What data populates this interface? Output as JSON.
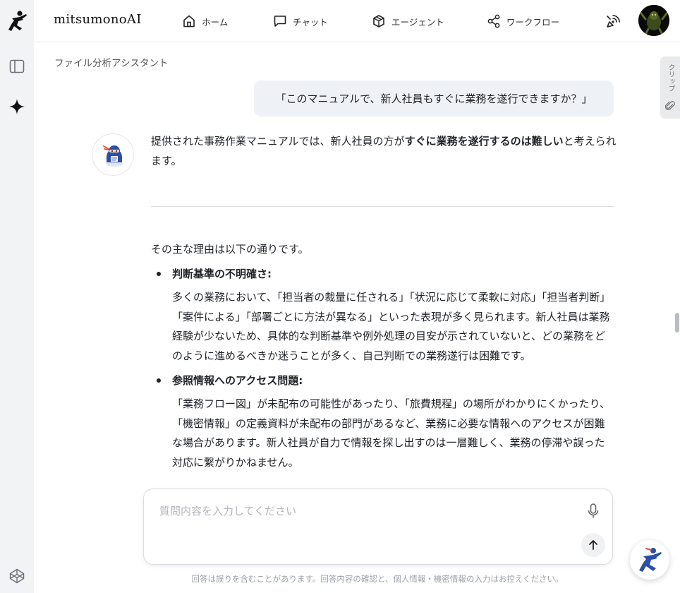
{
  "header": {
    "brand": "mitsumonoAI",
    "nav": [
      {
        "label": "ホーム",
        "icon": "home-icon"
      },
      {
        "label": "チャット",
        "icon": "chat-icon"
      },
      {
        "label": "エージェント",
        "icon": "cube-icon"
      },
      {
        "label": "ワークフロー",
        "icon": "share-icon"
      }
    ]
  },
  "page": {
    "title": "ファイル分析アシスタント"
  },
  "clip_tab": {
    "label": "クリップ"
  },
  "conversation": {
    "user_message": "「このマニュアルで、新人社員もすぐに業務を遂行できますか？」",
    "answer_pre": "提供された事務作業マニュアルでは、新人社員の方が",
    "answer_bold": "すぐに業務を遂行するのは難しい",
    "answer_post": "と考えられます。",
    "reasons_lead": "その主な理由は以下の通りです。",
    "reasons": [
      {
        "title": "判断基準の不明確さ:",
        "body": "多くの業務において、「担当者の裁量に任される」「状況に応じて柔軟に対応」「担当者判断」「案件による」「部署ごとに方法が異なる」といった表現が多く見られます。新人社員は業務経験が少ないため、具体的な判断基準や例外処理の目安が示されていないと、どの業務をどのように進めるべきか迷うことが多く、自己判断での業務遂行は困難です。"
      },
      {
        "title": "参照情報へのアクセス問題:",
        "body": "「業務フロー図」が未配布の可能性があったり、「旅費規程」の場所がわかりにくかったり、「機密情報」の定義資料が未配布の部門があるなど、業務に必要な情報へのアクセスが困難な場合があります。新人社員が自力で情報を探し出すのは一層難しく、業務の停滞や誤った対応に繋がりかねません。"
      }
    ]
  },
  "input": {
    "placeholder": "質問内容を入力してください"
  },
  "disclaimer": "回答は誤りを含むことがあります。回答内容の確認と、個人情報・機密情報の入力はお控えください。",
  "colors": {
    "accent": "#2b4fa8",
    "rail_bg": "#f2f3f5",
    "bubble_bg": "#eef1f6"
  }
}
